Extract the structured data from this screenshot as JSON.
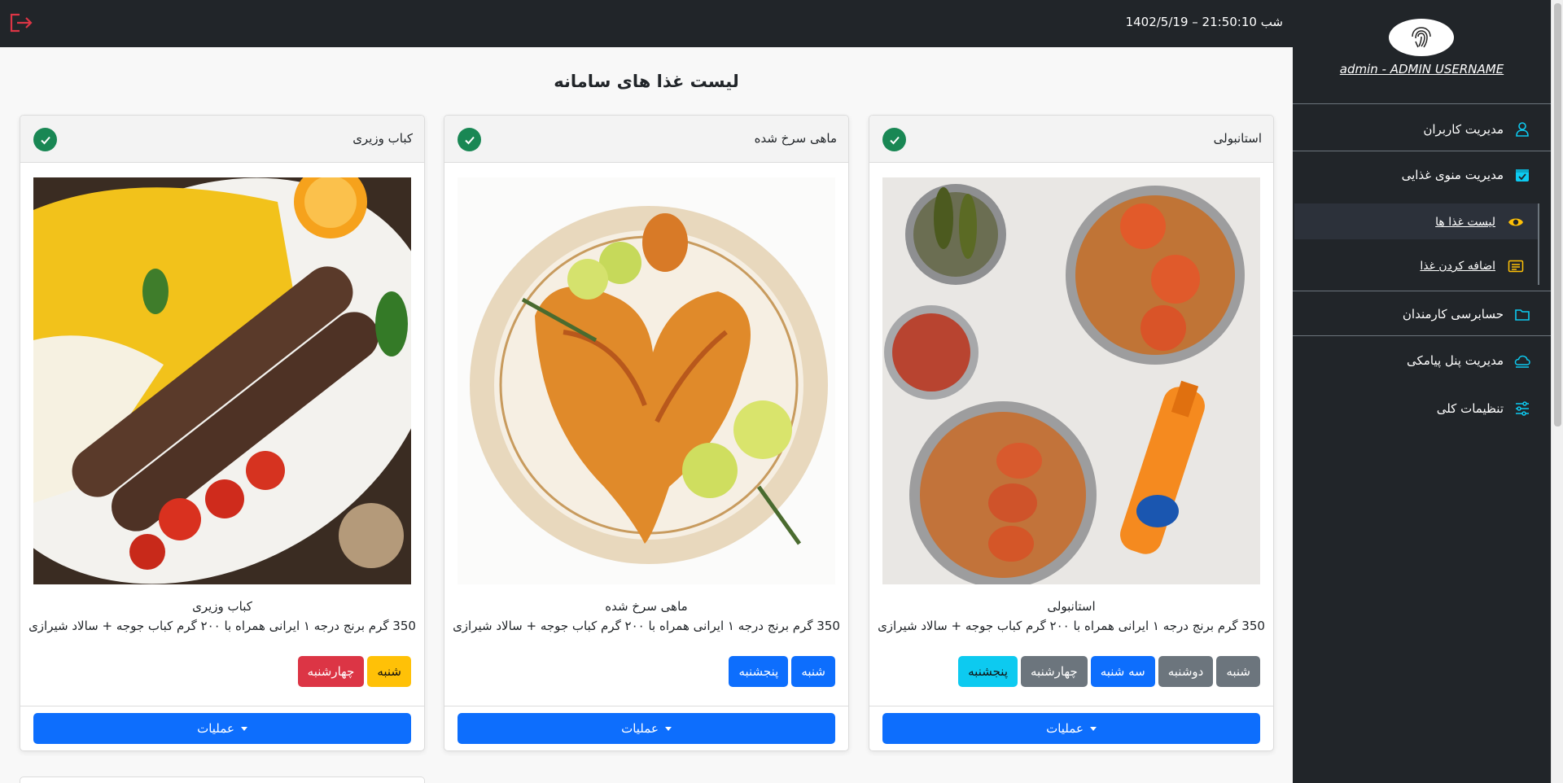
{
  "topbar": {
    "datetime": "شب 21:50:10 – 1402/5/19"
  },
  "sidebar": {
    "user": "admin - ADMIN USERNAME",
    "items": [
      {
        "label": "مدیریت کاربران",
        "icon": "user-icon"
      },
      {
        "label": "مدیریت منوی غذایی",
        "icon": "calendar-check-icon"
      },
      {
        "label": "حسابرسی کارمندان",
        "icon": "folder-icon"
      },
      {
        "label": "مدیریت پنل پیامکی",
        "icon": "cloud-icon"
      },
      {
        "label": "تنظیمات کلی",
        "icon": "sliders-icon"
      }
    ],
    "subitems": [
      {
        "label": "لیست غذا ها",
        "icon": "eye-icon"
      },
      {
        "label": "اضافه کردن غذا",
        "icon": "card-text-icon"
      }
    ]
  },
  "page": {
    "title": "لیست غذا های سامانه"
  },
  "colors": {
    "primary": "#0d6efd",
    "success": "#198754",
    "danger": "#dc3545",
    "warning": "#ffc107",
    "secondary": "#6c757d",
    "info": "#0dcaf0",
    "dark": "#212529"
  },
  "cards": [
    {
      "title": "استانبولی",
      "name": "استانبولی",
      "description": "350 گرم برنج درجه ۱ ایرانی همراه با ۲۰۰ گرم کباب جوجه + سالاد شیرازی",
      "days": [
        {
          "label": "شنبه",
          "color": "#6c757d"
        },
        {
          "label": "دوشنبه",
          "color": "#6c757d"
        },
        {
          "label": "سه شنبه",
          "color": "#0d6efd"
        },
        {
          "label": "چهارشنبه",
          "color": "#6c757d"
        },
        {
          "label": "پنجشنبه",
          "color": "#0dcaf0"
        }
      ],
      "ops_label": "عملیات"
    },
    {
      "title": "ماهی سرخ شده",
      "name": "ماهی سرخ شده",
      "description": "350 گرم برنج درجه ۱ ایرانی همراه با ۲۰۰ گرم کباب جوجه + سالاد شیرازی",
      "days": [
        {
          "label": "شنبه",
          "color": "#0d6efd"
        },
        {
          "label": "پنجشنبه",
          "color": "#0d6efd"
        }
      ],
      "ops_label": "عملیات"
    },
    {
      "title": "کباب وزیری",
      "name": "کباب وزیری",
      "description": "350 گرم برنج درجه ۱ ایرانی همراه با ۲۰۰ گرم کباب جوجه + سالاد شیرازی",
      "days": [
        {
          "label": "شنبه",
          "color": "#ffc107"
        },
        {
          "label": "چهارشنبه",
          "color": "#dc3545"
        }
      ],
      "ops_label": "عملیات"
    }
  ]
}
